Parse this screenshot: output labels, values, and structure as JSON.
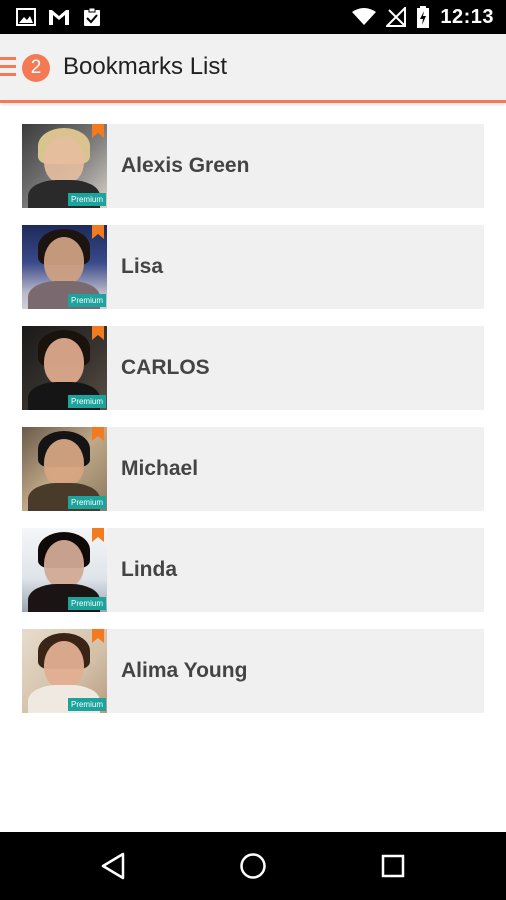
{
  "status_bar": {
    "time": "12:13",
    "left_icons": [
      "image-icon",
      "gmail-icon",
      "clipboard-check-icon"
    ],
    "right_icons": [
      "wifi-icon",
      "no-signal-icon",
      "battery-charging-icon"
    ]
  },
  "app_bar": {
    "badge_count": "2",
    "title": "Bookmarks List",
    "accent_color": "#f47a56"
  },
  "bookmarks": [
    {
      "name": "Alexis Green",
      "badge": "Premium"
    },
    {
      "name": "Lisa",
      "badge": "Premium"
    },
    {
      "name": "CARLOS",
      "badge": "Premium"
    },
    {
      "name": "Michael",
      "badge": "Premium"
    },
    {
      "name": "Linda",
      "badge": "Premium"
    },
    {
      "name": "Alima Young",
      "badge": "Premium"
    }
  ],
  "nav_bar": {
    "icons": [
      "back-icon",
      "home-icon",
      "recents-icon"
    ]
  },
  "colors": {
    "premium_badge": "#1ba39c",
    "bookmark_ribbon": "#f47a1f",
    "row_background": "#f0f0f0"
  }
}
